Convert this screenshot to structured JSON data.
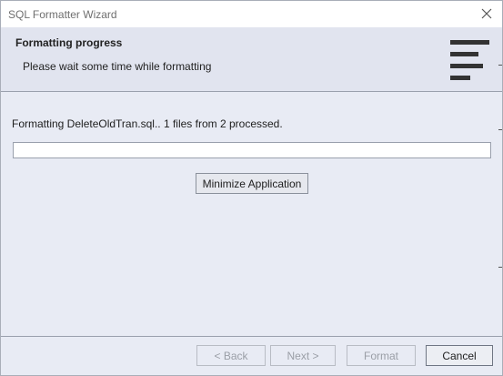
{
  "window": {
    "title": "SQL Formatter Wizard"
  },
  "header": {
    "title": "Formatting progress",
    "subtitle": "Please wait some time while formatting",
    "icon": "formatting-lines-icon"
  },
  "content": {
    "status": "Formatting DeleteOldTran.sql.. 1 files from 2 processed.",
    "progress_percent": 0,
    "minimize_label": "Minimize Application"
  },
  "footer": {
    "back_label": "< Back",
    "next_label": "Next >",
    "format_label": "Format",
    "cancel_label": "Cancel"
  },
  "colors": {
    "accent": "#3c7fd1",
    "panel": "#e8ebf4",
    "header": "#e1e4ef"
  }
}
